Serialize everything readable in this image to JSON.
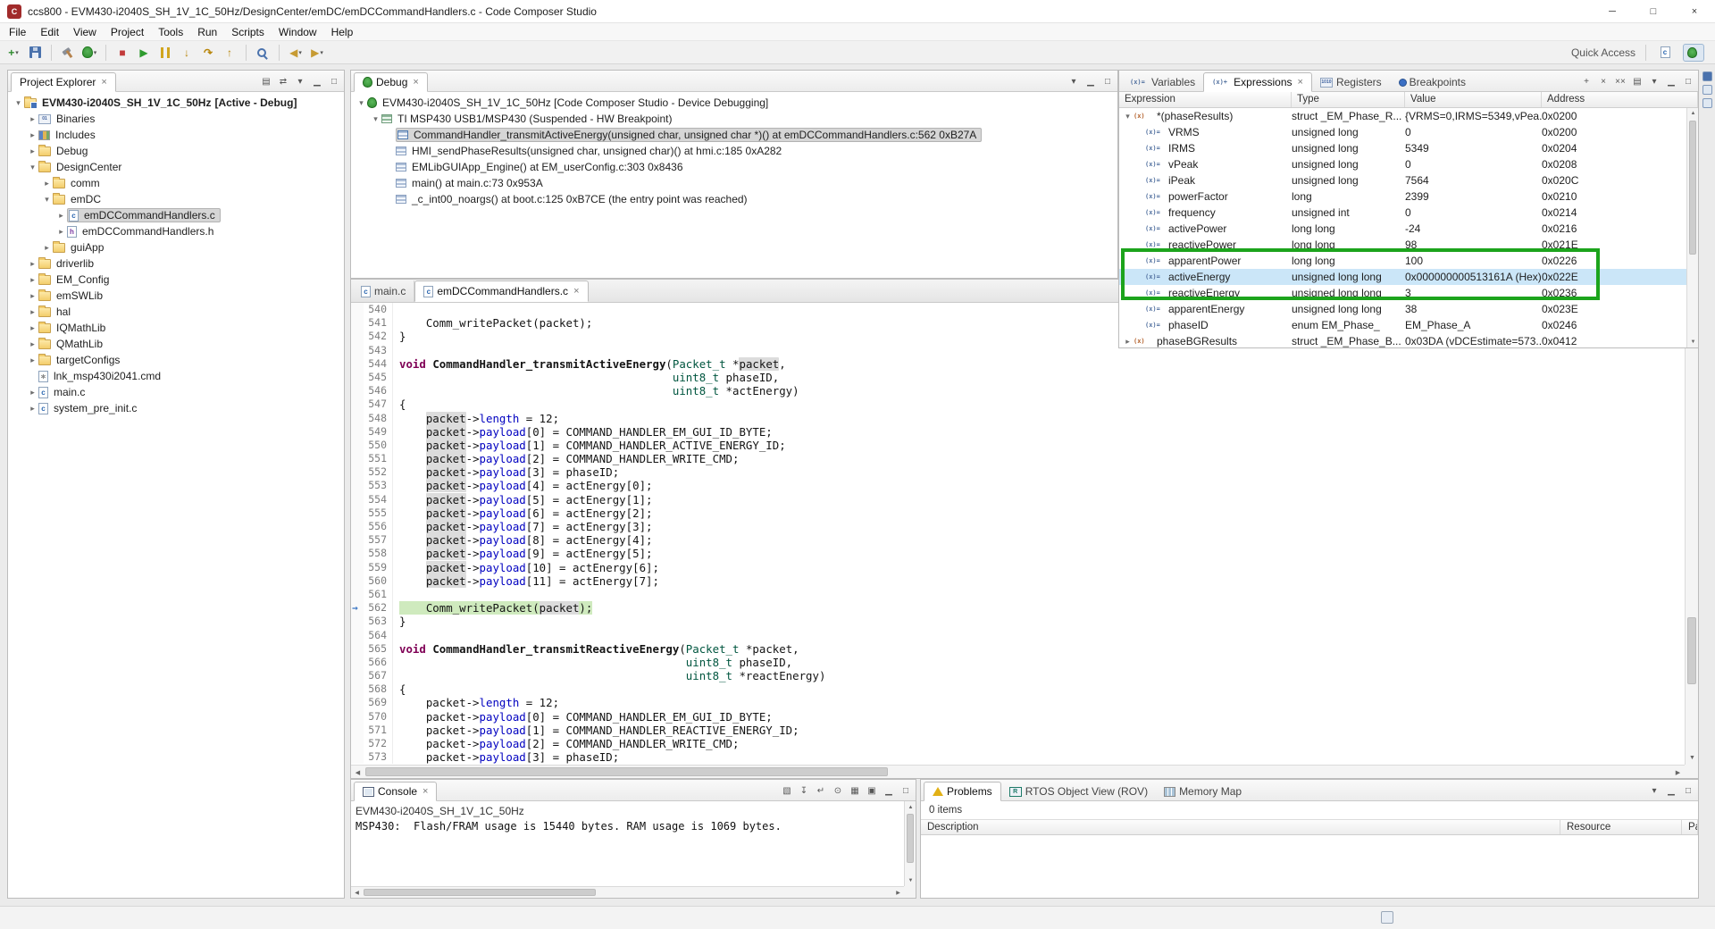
{
  "window": {
    "title": "ccs800 - EVM430-i2040S_SH_1V_1C_50Hz/DesignCenter/emDC/emDCCommandHandlers.c - Code Composer Studio"
  },
  "menu": {
    "items": [
      "File",
      "Edit",
      "View",
      "Project",
      "Tools",
      "Run",
      "Scripts",
      "Window",
      "Help"
    ]
  },
  "toolbar": {
    "quick_access": "Quick Access",
    "buttons": [
      {
        "name": "new-wizard",
        "dropdown": true
      },
      {
        "name": "save"
      },
      {
        "sep": true
      },
      {
        "name": "build"
      },
      {
        "name": "debug",
        "dropdown": true
      },
      {
        "sep": true
      },
      {
        "name": "terminate"
      },
      {
        "name": "resume"
      },
      {
        "name": "suspend"
      },
      {
        "name": "step-into"
      },
      {
        "name": "step-over"
      },
      {
        "name": "step-return"
      },
      {
        "sep": true
      },
      {
        "name": "search"
      },
      {
        "sep": true
      },
      {
        "name": "back",
        "dropdown": true
      },
      {
        "name": "forward",
        "dropdown": true
      }
    ]
  },
  "project_explorer": {
    "title": "Project Explorer",
    "toolbar": [
      "collapse-all",
      "link-with-editor",
      "view-menu",
      "minimize",
      "maximize"
    ],
    "items": [
      {
        "label": "EVM430-i2040S_SH_1V_1C_50Hz",
        "suffix": " [Active - Debug]",
        "depth": 0,
        "icon": "project",
        "expander": "open",
        "bold": true
      },
      {
        "label": "Binaries",
        "depth": 1,
        "icon": "binaries",
        "expander": "closed"
      },
      {
        "label": "Includes",
        "depth": 1,
        "icon": "includes",
        "expander": "closed"
      },
      {
        "label": "Debug",
        "depth": 1,
        "icon": "folder",
        "expander": "closed"
      },
      {
        "label": "DesignCenter",
        "depth": 1,
        "icon": "folder",
        "expander": "open"
      },
      {
        "label": "comm",
        "depth": 2,
        "icon": "folder",
        "expander": "closed"
      },
      {
        "label": "emDC",
        "depth": 2,
        "icon": "folder",
        "expander": "open"
      },
      {
        "label": "emDCCommandHandlers.c",
        "depth": 3,
        "icon": "cfile",
        "expander": "closed",
        "selected": true
      },
      {
        "label": "emDCCommandHandlers.h",
        "depth": 3,
        "icon": "hfile",
        "expander": "closed"
      },
      {
        "label": "guiApp",
        "depth": 2,
        "icon": "folder",
        "expander": "closed"
      },
      {
        "label": "driverlib",
        "depth": 1,
        "icon": "folder",
        "expander": "closed"
      },
      {
        "label": "EM_Config",
        "depth": 1,
        "icon": "folder",
        "expander": "closed"
      },
      {
        "label": "emSWLib",
        "depth": 1,
        "icon": "folder",
        "expander": "closed"
      },
      {
        "label": "hal",
        "depth": 1,
        "icon": "folder",
        "expander": "closed"
      },
      {
        "label": "IQMathLib",
        "depth": 1,
        "icon": "folder",
        "expander": "closed"
      },
      {
        "label": "QMathLib",
        "depth": 1,
        "icon": "folder",
        "expander": "closed"
      },
      {
        "label": "targetConfigs",
        "depth": 1,
        "icon": "folder",
        "expander": "closed"
      },
      {
        "label": "lnk_msp430i2041.cmd",
        "depth": 1,
        "icon": "cmdfile",
        "expander": "none"
      },
      {
        "label": "main.c",
        "depth": 1,
        "icon": "cfile",
        "expander": "closed"
      },
      {
        "label": "system_pre_init.c",
        "depth": 1,
        "icon": "cfile",
        "expander": "closed"
      }
    ]
  },
  "debug": {
    "title": "Debug",
    "toolbar": [
      "view-menu",
      "minimize",
      "maximize"
    ],
    "items": [
      {
        "label": "EVM430-i2040S_SH_1V_1C_50Hz [Code Composer Studio - Device Debugging]",
        "depth": 0,
        "icon": "debug-target",
        "expander": "open"
      },
      {
        "label": "TI MSP430 USB1/MSP430 (Suspended - HW Breakpoint)",
        "depth": 1,
        "icon": "thread",
        "expander": "open"
      },
      {
        "label": "CommandHandler_transmitActiveEnergy(unsigned char, unsigned char *)() at emDCCommandHandlers.c:562 0xB27A",
        "depth": 2,
        "icon": "stackframe-current",
        "expander": "none",
        "selected": true
      },
      {
        "label": "HMI_sendPhaseResults(unsigned char, unsigned char)() at hmi.c:185 0xA282",
        "depth": 2,
        "icon": "stackframe",
        "expander": "none"
      },
      {
        "label": "EMLibGUIApp_Engine() at EM_userConfig.c:303 0x8436",
        "depth": 2,
        "icon": "stackframe",
        "expander": "none"
      },
      {
        "label": "main() at main.c:73 0x953A",
        "depth": 2,
        "icon": "stackframe",
        "expander": "none"
      },
      {
        "label": "_c_int00_noargs() at boot.c:125 0xB7CE  (the entry point was reached)",
        "depth": 2,
        "icon": "stackframe",
        "expander": "none"
      }
    ]
  },
  "expressions": {
    "tabs": [
      {
        "label": "Variables",
        "icon": "variables"
      },
      {
        "label": "Expressions",
        "icon": "expressions",
        "active": true
      },
      {
        "label": "Registers",
        "icon": "registers"
      },
      {
        "label": "Breakpoints",
        "icon": "breakpoints"
      }
    ],
    "toolbar": [
      "add-expression",
      "remove-expression",
      "remove-all",
      "collapse-all",
      "view-menu",
      "minimize",
      "maximize"
    ],
    "columns": [
      "Expression",
      "Type",
      "Value",
      "Address"
    ],
    "rows": [
      {
        "expression": "*(phaseResults)",
        "type": "struct _EM_Phase_R...",
        "value": "{VRMS=0,IRMS=5349,vPea...",
        "address": "0x0200",
        "depth": 0,
        "expander": "open",
        "icon": "struct"
      },
      {
        "expression": "VRMS",
        "type": "unsigned long",
        "value": "0",
        "address": "0x0200",
        "depth": 1,
        "expander": "none",
        "icon": "var"
      },
      {
        "expression": "IRMS",
        "type": "unsigned long",
        "value": "5349",
        "address": "0x0204",
        "depth": 1,
        "expander": "none",
        "icon": "var"
      },
      {
        "expression": "vPeak",
        "type": "unsigned long",
        "value": "0",
        "address": "0x0208",
        "depth": 1,
        "expander": "none",
        "icon": "var"
      },
      {
        "expression": "iPeak",
        "type": "unsigned long",
        "value": "7564",
        "address": "0x020C",
        "depth": 1,
        "expander": "none",
        "icon": "var"
      },
      {
        "expression": "powerFactor",
        "type": "long",
        "value": "2399",
        "address": "0x0210",
        "depth": 1,
        "expander": "none",
        "icon": "var"
      },
      {
        "expression": "frequency",
        "type": "unsigned int",
        "value": "0",
        "address": "0x0214",
        "depth": 1,
        "expander": "none",
        "icon": "var"
      },
      {
        "expression": "activePower",
        "type": "long long",
        "value": "-24",
        "address": "0x0216",
        "depth": 1,
        "expander": "none",
        "icon": "var"
      },
      {
        "expression": "reactivePower",
        "type": "long long",
        "value": "98",
        "address": "0x021E",
        "depth": 1,
        "expander": "none",
        "icon": "var"
      },
      {
        "expression": "apparentPower",
        "type": "long long",
        "value": "100",
        "address": "0x0226",
        "depth": 1,
        "expander": "none",
        "icon": "var"
      },
      {
        "expression": "activeEnergy",
        "type": "unsigned long long",
        "value": "0x000000000513161A (Hex)",
        "address": "0x022E",
        "depth": 1,
        "expander": "none",
        "icon": "var",
        "selected": true
      },
      {
        "expression": "reactiveEnergy",
        "type": "unsigned long long",
        "value": "3",
        "address": "0x0236",
        "depth": 1,
        "expander": "none",
        "icon": "var"
      },
      {
        "expression": "apparentEnergy",
        "type": "unsigned long long",
        "value": "38",
        "address": "0x023E",
        "depth": 1,
        "expander": "none",
        "icon": "var"
      },
      {
        "expression": "phaseID",
        "type": "enum EM_Phase_",
        "value": "EM_Phase_A",
        "address": "0x0246",
        "depth": 1,
        "expander": "none",
        "icon": "var"
      },
      {
        "expression": "phaseBGResults",
        "type": "struct _EM_Phase_B...",
        "value": "0x03DA (vDCEstimate=573...",
        "address": "0x0412",
        "depth": 0,
        "expander": "closed",
        "icon": "struct"
      }
    ]
  },
  "editor": {
    "tabs": [
      {
        "label": "main.c",
        "icon": "cfile"
      },
      {
        "label": "emDCCommandHandlers.c",
        "icon": "cfile",
        "active": true
      }
    ],
    "first_line": 540,
    "current_line": 562,
    "occurrence_word": "packet",
    "occurrence_range": [
      544,
      562
    ],
    "lines": [
      "",
      "    Comm_writePacket(packet);",
      "}",
      "",
      "void CommandHandler_transmitActiveEnergy(Packet_t *packet,",
      "                                         uint8_t phaseID,",
      "                                         uint8_t *actEnergy)",
      "{",
      "    packet->length = 12;",
      "    packet->payload[0] = COMMAND_HANDLER_EM_GUI_ID_BYTE;",
      "    packet->payload[1] = COMMAND_HANDLER_ACTIVE_ENERGY_ID;",
      "    packet->payload[2] = COMMAND_HANDLER_WRITE_CMD;",
      "    packet->payload[3] = phaseID;",
      "    packet->payload[4] = actEnergy[0];",
      "    packet->payload[5] = actEnergy[1];",
      "    packet->payload[6] = actEnergy[2];",
      "    packet->payload[7] = actEnergy[3];",
      "    packet->payload[8] = actEnergy[4];",
      "    packet->payload[9] = actEnergy[5];",
      "    packet->payload[10] = actEnergy[6];",
      "    packet->payload[11] = actEnergy[7];",
      "",
      "    Comm_writePacket(packet);",
      "}",
      "",
      "void CommandHandler_transmitReactiveEnergy(Packet_t *packet,",
      "                                           uint8_t phaseID,",
      "                                           uint8_t *reactEnergy)",
      "{",
      "    packet->length = 12;",
      "    packet->payload[0] = COMMAND_HANDLER_EM_GUI_ID_BYTE;",
      "    packet->payload[1] = COMMAND_HANDLER_REACTIVE_ENERGY_ID;",
      "    packet->payload[2] = COMMAND_HANDLER_WRITE_CMD;",
      "    packet->payload[3] = phaseID;"
    ]
  },
  "console": {
    "title": "Console",
    "toolbar": [
      "clear-console",
      "scroll-lock",
      "word-wrap",
      "pin-console",
      "display-selected-console",
      "open-console",
      "minimize",
      "maximize"
    ],
    "name_line": "EVM430-i2040S_SH_1V_1C_50Hz",
    "output": "MSP430:  Flash/FRAM usage is 15440 bytes. RAM usage is 1069 bytes."
  },
  "problems": {
    "tabs": [
      {
        "label": "Problems",
        "icon": "problemstab",
        "active": true
      },
      {
        "label": "RTOS Object View (ROV)",
        "icon": "rovtab"
      },
      {
        "label": "Memory Map",
        "icon": "memmaptab"
      }
    ],
    "toolbar": [
      "view-menu",
      "minimize",
      "maximize"
    ],
    "summary": "0 items",
    "columns": [
      "Description",
      "Resource",
      "Pat"
    ]
  },
  "fastbar": {
    "icons": [
      "restore-views",
      "minimized-view-a",
      "minimized-view-b"
    ]
  },
  "annotation": {
    "type": "highlight-box",
    "color": "#1ca41c"
  }
}
